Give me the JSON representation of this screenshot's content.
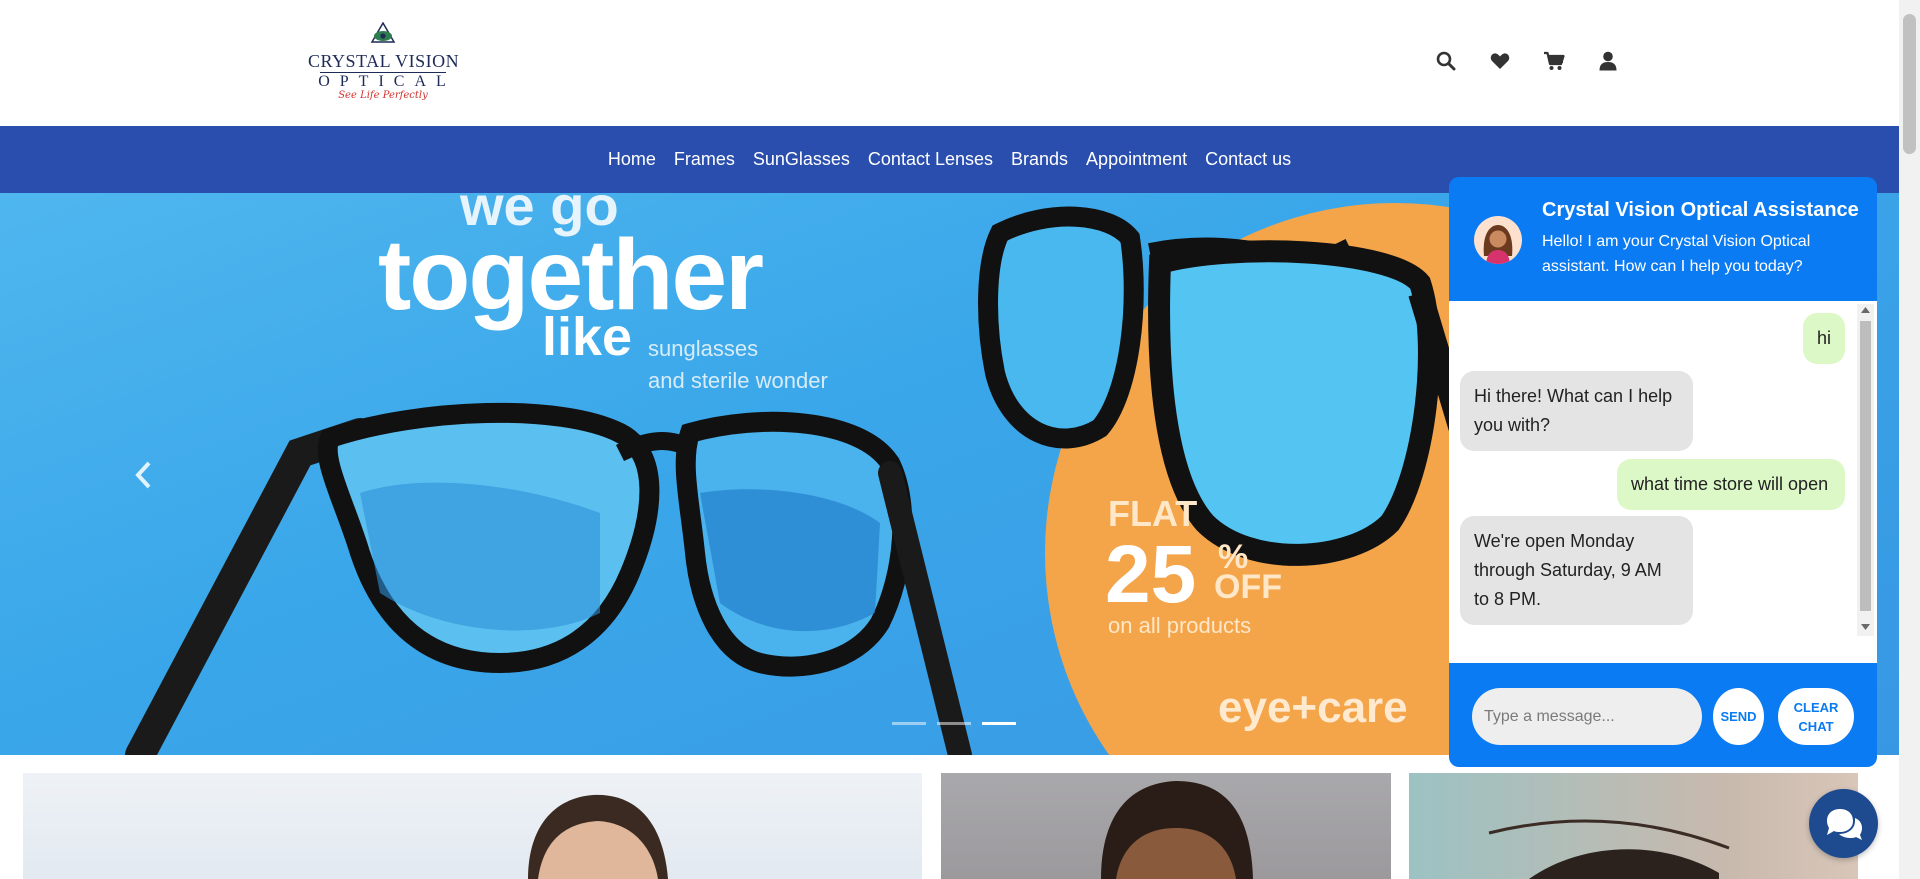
{
  "brand": {
    "line1": "CRYSTAL VISION",
    "line2": "OPTICAL",
    "tagline": "See Life Perfectly"
  },
  "header_icons": [
    "search-icon",
    "heart-icon",
    "cart-icon",
    "user-icon"
  ],
  "nav": {
    "items": [
      {
        "label": "Home"
      },
      {
        "label": "Frames"
      },
      {
        "label": "SunGlasses"
      },
      {
        "label": "Contact Lenses"
      },
      {
        "label": "Brands"
      },
      {
        "label": "Appointment"
      },
      {
        "label": "Contact us"
      }
    ]
  },
  "hero": {
    "text_we": "we go",
    "text_together": "together",
    "text_like": "like",
    "text_sunglasses": "sunglasses",
    "text_wonder": "and sterile wonder",
    "promo_flat": "FLAT",
    "promo_value": "25",
    "promo_percent": "%",
    "promo_off": "OFF",
    "promo_scope": "on all products",
    "promo_brand": "eye+care",
    "slides_total": 3,
    "slide_active": 3
  },
  "chat": {
    "title": "Crystal Vision Optical Assistance",
    "greeting": "Hello! I am your Crystal Vision Optical assistant. How can I help you today?",
    "messages": [
      {
        "from": "user",
        "text": "hi"
      },
      {
        "from": "bot",
        "text": "Hi there! What can I help you with?"
      },
      {
        "from": "user",
        "text": "what time store will open"
      },
      {
        "from": "bot",
        "text": "We're open Monday through Saturday, 9 AM to 8 PM."
      }
    ],
    "input_placeholder": "Type a message...",
    "send_label": "SEND",
    "clear_label": "CLEAR CHAT"
  },
  "colors": {
    "nav_bg": "#2a4eae",
    "chat_accent": "#0a7bf2",
    "user_bubble": "#dcf8c6",
    "bot_bubble": "#e4e4e4",
    "fab_bg": "#1e4b8f"
  }
}
